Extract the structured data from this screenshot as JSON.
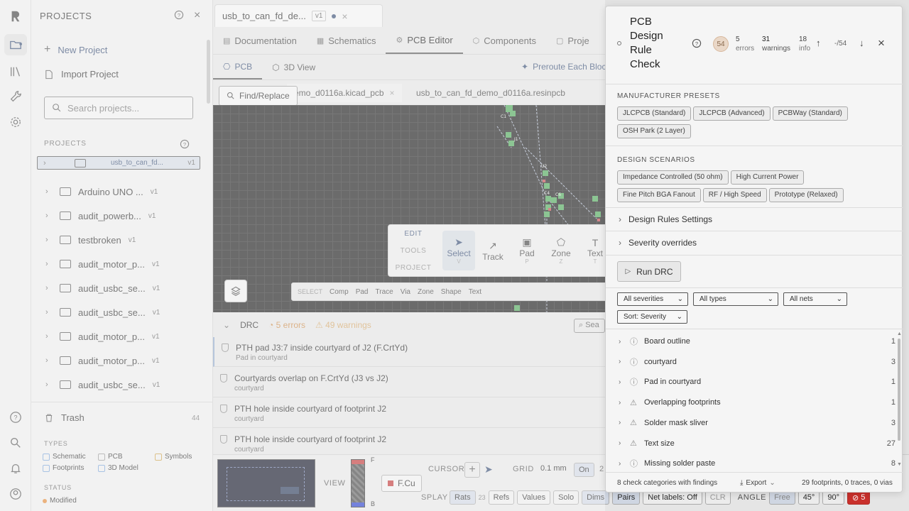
{
  "projects_panel": {
    "title": "PROJECTS",
    "new_project": "New Project",
    "import_project": "Import Project",
    "search_placeholder": "Search projects...",
    "section_label": "PROJECTS",
    "items": [
      {
        "name": "usb_to_can_fd...",
        "ver": "v1"
      },
      {
        "name": "Arduino UNO ...",
        "ver": "v1"
      },
      {
        "name": "audit_powerb...",
        "ver": "v1"
      },
      {
        "name": "testbroken",
        "ver": "v1"
      },
      {
        "name": "audit_motor_p...",
        "ver": "v1"
      },
      {
        "name": "audit_usbc_se...",
        "ver": "v1"
      },
      {
        "name": "audit_usbc_se...",
        "ver": "v1"
      },
      {
        "name": "audit_motor_p...",
        "ver": "v1"
      },
      {
        "name": "audit_motor_p...",
        "ver": "v1"
      },
      {
        "name": "audit_usbc_se...",
        "ver": "v1"
      }
    ],
    "trash_label": "Trash",
    "trash_count": "44",
    "types_label": "TYPES",
    "types": [
      "Schematic",
      "PCB",
      "Symbols",
      "Footprints",
      "3D Model"
    ],
    "status_label": "STATUS",
    "status_value": "Modified"
  },
  "editor": {
    "file_tab": "usb_to_can_fd_de...",
    "file_ver": "v1",
    "tabs": [
      "Documentation",
      "Schematics",
      "PCB Editor",
      "Components",
      "Proje"
    ],
    "subtabs": [
      "PCB",
      "3D View"
    ],
    "preroute": "Preroute Each Block",
    "find_replace": "Find/Replace",
    "doc_tab_1": "emo_d0116a.kicad_pcb",
    "doc_tab_2": "usb_to_can_fd_demo_d0116a.resinpcb",
    "tool_tabs": [
      "EDIT",
      "TOOLS",
      "PROJECT"
    ],
    "tools": [
      {
        "label": "Select",
        "key": "V"
      },
      {
        "label": "Track",
        "key": ""
      },
      {
        "label": "Pad",
        "key": "P"
      },
      {
        "label": "Zone",
        "key": "Z"
      },
      {
        "label": "Text",
        "key": "T"
      }
    ],
    "select_bar": [
      "SELECT",
      "Comp",
      "Pad",
      "Trace",
      "Via",
      "Zone",
      "Shape",
      "Text"
    ],
    "drc_label": "DRC",
    "drc_errors": "5 errors",
    "drc_warnings": "49 warnings",
    "drc_search": "Sea",
    "drc_rows": [
      {
        "title": "PTH pad J3:7 inside courtyard of J2 (F.CrtYd)",
        "sub": "Pad in courtyard"
      },
      {
        "title": "Courtyards overlap on F.CrtYd (J3 vs J2)",
        "sub": "courtyard"
      },
      {
        "title": "PTH hole inside courtyard of footprint J2",
        "sub": "courtyard"
      },
      {
        "title": "PTH hole inside courtyard of footprint J2",
        "sub": "courtyard"
      }
    ],
    "bottom": {
      "view": "VIEW",
      "layer": "F.Cu",
      "layer_top": "F",
      "layer_bot": "B",
      "cursor": "CURSOR",
      "grid": "GRID",
      "grid_val": "0.1 mm",
      "on": "On",
      "grid_trail": "2",
      "display": "SPLAY",
      "rats": "Rats",
      "rats_count": "23",
      "refs": "Refs",
      "values": "Values",
      "solo": "Solo",
      "dims": "Dims",
      "pairs": "Pairs",
      "net_labels": "Net labels: Off",
      "clr": "CLR",
      "angle": "ANGLE",
      "free": "Free",
      "a45": "45°",
      "a90": "90°",
      "err_count": "5"
    }
  },
  "drc_modal": {
    "title": "PCB Design Rule Check",
    "total": "54",
    "errors_num": "5",
    "errors_lbl": "errors",
    "warnings_num": "31",
    "warnings_lbl": "warnings",
    "info_num": "18",
    "info_lbl": "info",
    "nav": "-/54",
    "presets_label": "MANUFACTURER PRESETS",
    "presets": [
      "JLCPCB (Standard)",
      "JLCPCB (Advanced)",
      "PCBWay (Standard)",
      "OSH Park (2 Layer)"
    ],
    "scenarios_label": "DESIGN SCENARIOS",
    "scenarios": [
      "Impedance Controlled (50 ohm)",
      "High Current Power",
      "Fine Pitch BGA Fanout",
      "RF / High Speed",
      "Prototype (Relaxed)"
    ],
    "rules_settings": "Design Rules Settings",
    "severity_overrides": "Severity overrides",
    "run": "Run DRC",
    "filters": [
      "All severities",
      "All types",
      "All nets",
      "Sort: Severity"
    ],
    "categories": [
      {
        "name": "Board outline",
        "count": "1",
        "icon": "info"
      },
      {
        "name": "courtyard",
        "count": "3",
        "icon": "info"
      },
      {
        "name": "Pad in courtyard",
        "count": "1",
        "icon": "info"
      },
      {
        "name": "Overlapping footprints",
        "count": "1",
        "icon": "warn"
      },
      {
        "name": "Solder mask sliver",
        "count": "3",
        "icon": "warn"
      },
      {
        "name": "Text size",
        "count": "27",
        "icon": "warn"
      },
      {
        "name": "Missing solder paste",
        "count": "8",
        "icon": "info"
      }
    ],
    "footer_left": "8 check categories with findings",
    "export": "Export",
    "footer_right": "29 footprints, 0 traces, 0 vias"
  }
}
